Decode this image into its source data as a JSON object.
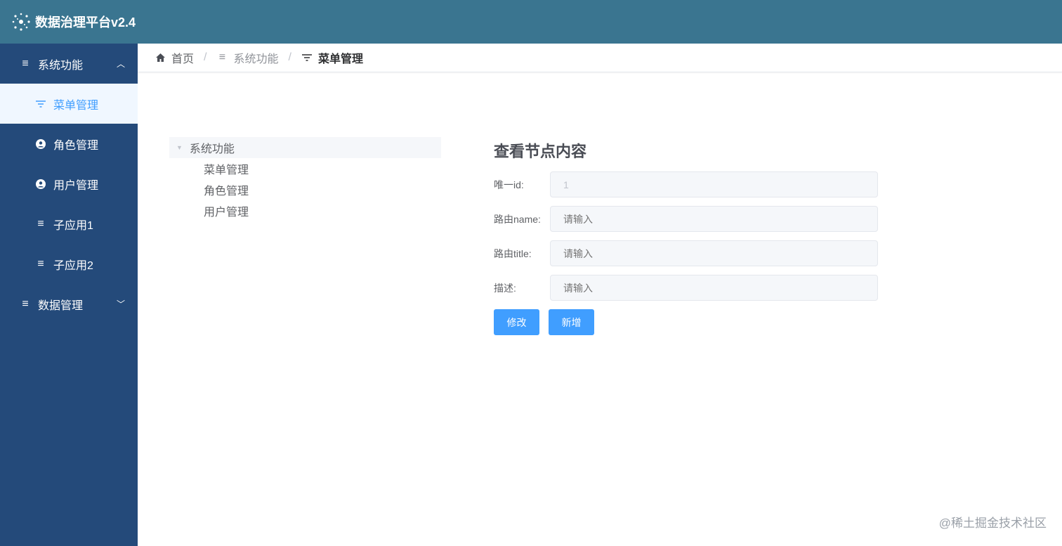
{
  "header": {
    "title": "数据治理平台v2.4",
    "logo_icon": "network-dots-icon"
  },
  "sidebar": {
    "groups": [
      {
        "label": "系统功能",
        "expanded": true,
        "items": [
          {
            "label": "菜单管理",
            "icon": "filter-icon",
            "active": true
          },
          {
            "label": "角色管理",
            "icon": "user-circle-icon"
          },
          {
            "label": "用户管理",
            "icon": "user-circle-icon"
          },
          {
            "label": "子应用1",
            "icon": "menu-icon"
          },
          {
            "label": "子应用2",
            "icon": "menu-icon"
          }
        ]
      },
      {
        "label": "数据管理",
        "expanded": false
      }
    ]
  },
  "breadcrumb": [
    "首页",
    "系统功能",
    "菜单管理"
  ],
  "tree": {
    "root": "系统功能",
    "children": [
      "菜单管理",
      "角色管理",
      "用户管理"
    ]
  },
  "form": {
    "title": "查看节点内容",
    "fields": [
      {
        "label": "唯一id:",
        "value": "1",
        "placeholder": ""
      },
      {
        "label": "路由name:",
        "value": "",
        "placeholder": "请输入"
      },
      {
        "label": "路由title:",
        "value": "",
        "placeholder": "请输入"
      },
      {
        "label": "描述:",
        "value": "",
        "placeholder": "请输入"
      }
    ],
    "buttons": {
      "edit": "修改",
      "add": "新增"
    }
  },
  "watermark": "@稀土掘金技术社区",
  "colors": {
    "header": "#3a7590",
    "sidebar": "#244a7a",
    "accent": "#409eff"
  }
}
